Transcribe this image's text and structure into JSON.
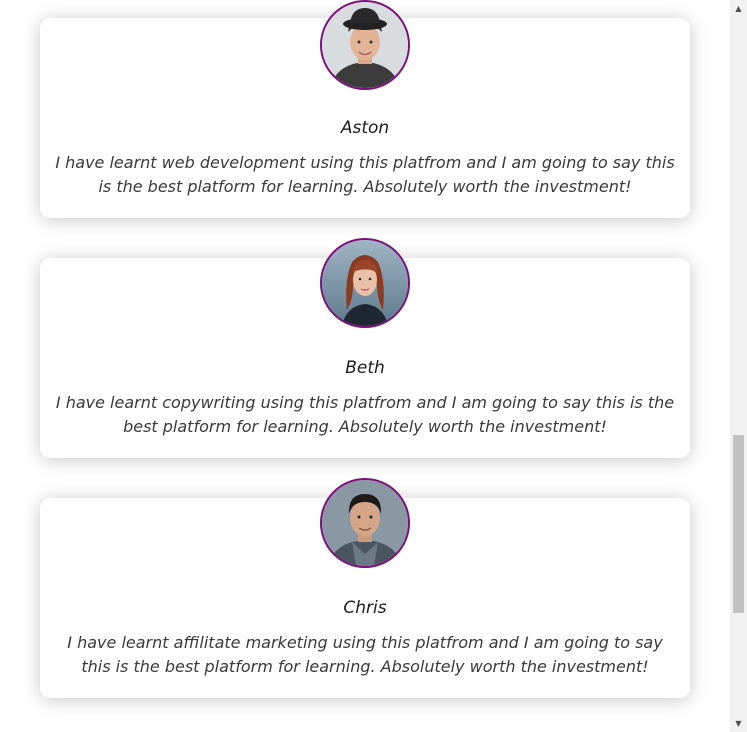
{
  "testimonials": [
    {
      "name": "Aston",
      "quote": "I have learnt web development using this platfrom and I am going to say this is the best platform for learning. Absolutely worth the investment!",
      "avatar_icon": "avatar-young-man-hat"
    },
    {
      "name": "Beth",
      "quote": "I have learnt copywriting using this platfrom and I am going to say this is the best platform for learning. Absolutely worth the investment!",
      "avatar_icon": "avatar-woman-red-hair"
    },
    {
      "name": "Chris",
      "quote": "I have learnt affilitate marketing using this platfrom and I am going to say this is the best platform for learning. Absolutely worth the investment!",
      "avatar_icon": "avatar-man-dark-hair"
    }
  ],
  "colors": {
    "avatar_border": "#7c0f7c",
    "card_bg": "#ffffff",
    "name_text": "#1c1c1c",
    "quote_text": "#3a3a3a"
  },
  "scrollbar": {
    "up_arrow_icon": "chevron-up-icon",
    "down_arrow_icon": "chevron-down-icon"
  }
}
